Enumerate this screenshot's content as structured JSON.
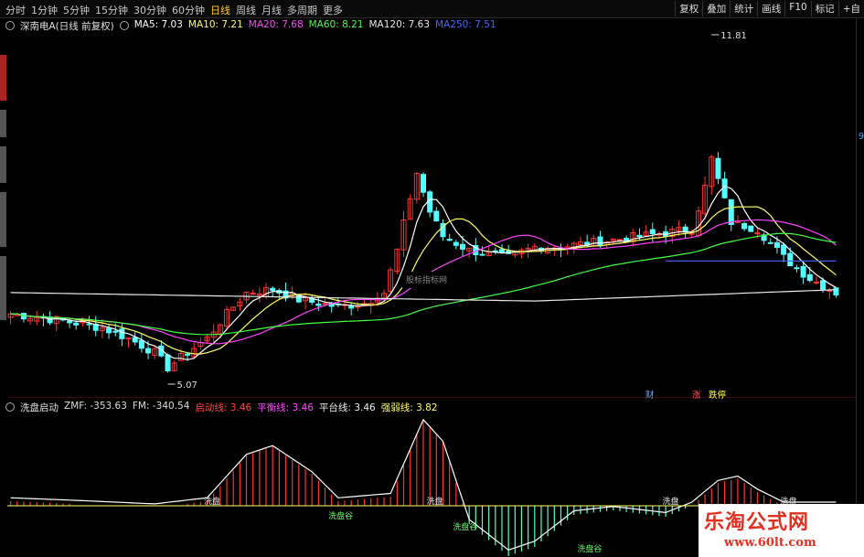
{
  "toolbar": {
    "tabs": [
      "分时",
      "1分钟",
      "5分钟",
      "15分钟",
      "30分钟",
      "60分钟",
      "日线",
      "周线",
      "月线",
      "多周期",
      "更多"
    ],
    "active_tab": "日线",
    "tools": [
      "复权",
      "叠加",
      "统计",
      "画线",
      "F10",
      "标记",
      "+自"
    ]
  },
  "main_legend": {
    "title": "深南电A(日线 前复权)",
    "ma": [
      {
        "label": "MA5: 7.03",
        "color": "#ffffff"
      },
      {
        "label": "MA10: 7.21",
        "color": "#ffff66"
      },
      {
        "label": "MA20: 7.68",
        "color": "#ff44ff"
      },
      {
        "label": "MA60: 8.21",
        "color": "#44ff44"
      },
      {
        "label": "MA120: 7.63",
        "color": "#e8e8e8"
      },
      {
        "label": "MA250: 7.51",
        "color": "#4466ff"
      }
    ]
  },
  "annotations": {
    "high": "11.81",
    "low": "5.07",
    "watermark_text": "股标指标网",
    "flags": [
      {
        "label": "财",
        "color": "#55aaff"
      },
      {
        "label": "涨",
        "color": "#ff5555"
      },
      {
        "label": "跌停",
        "color": "#ffff44"
      }
    ],
    "side_value": "9",
    "sub_signals_top": "洗盘",
    "sub_signals_bottom": "洗盘谷"
  },
  "sub_legend": {
    "name": "洗盘启动",
    "items": [
      {
        "label": "ZMF: -353.63",
        "color": "#dddddd"
      },
      {
        "label": "FM: -340.54",
        "color": "#dddddd"
      },
      {
        "label": "启动线: 3.46",
        "color": "#ff4444"
      },
      {
        "label": "平衡线: 3.46",
        "color": "#ff44ff"
      },
      {
        "label": "平台线: 3.46",
        "color": "#eeeeee"
      },
      {
        "label": "强弱线: 3.82",
        "color": "#ffff66"
      }
    ]
  },
  "site_watermark": {
    "line1": "乐淘公式网",
    "line2": "www.60lt.com"
  },
  "chart_data": {
    "type": "candlestick",
    "series_main": [
      {
        "name": "MA5",
        "color": "#ffffff"
      },
      {
        "name": "MA10",
        "color": "#ffff66"
      },
      {
        "name": "MA20",
        "color": "#ff44ff"
      },
      {
        "name": "MA60",
        "color": "#44ff44"
      },
      {
        "name": "MA120",
        "color": "#e8e8e8"
      },
      {
        "name": "MA250",
        "color": "#4466ff"
      }
    ],
    "high_label": 11.81,
    "low_label": 5.07
  }
}
